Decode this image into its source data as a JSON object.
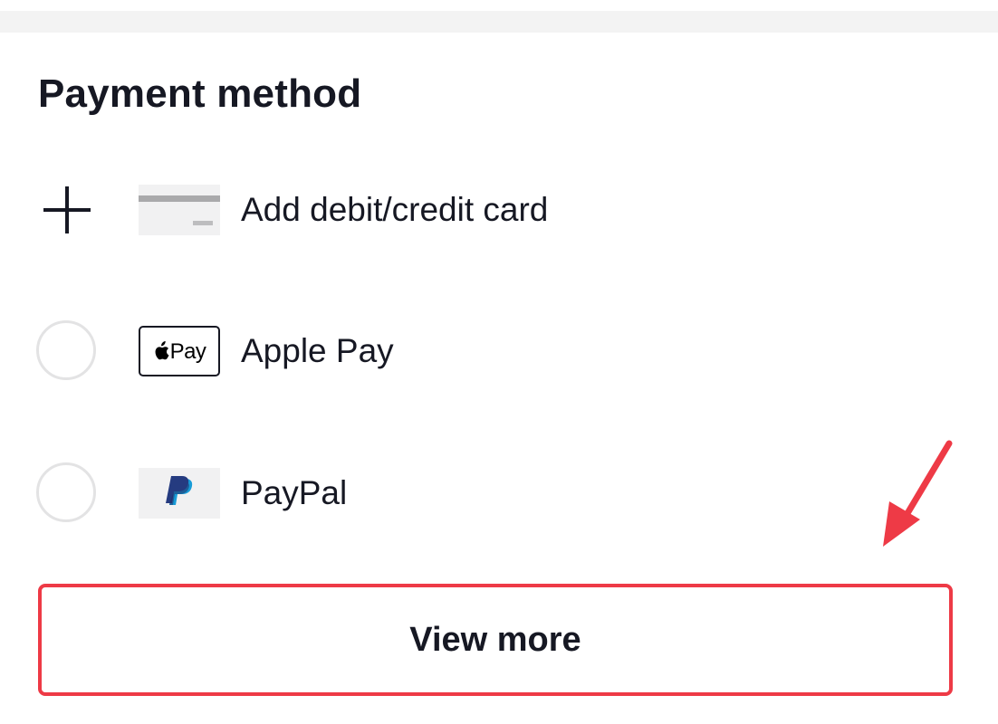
{
  "section": {
    "title": "Payment method"
  },
  "methods": [
    {
      "label": "Add debit/credit card",
      "leading_icon": "plus-icon",
      "logo": "card-icon"
    },
    {
      "label": "Apple Pay",
      "leading_icon": "radio-unselected",
      "logo": "apple-pay-logo",
      "logo_text": "Pay"
    },
    {
      "label": "PayPal",
      "leading_icon": "radio-unselected",
      "logo": "paypal-logo"
    }
  ],
  "view_more": {
    "label": "View more"
  },
  "colors": {
    "text": "#161823",
    "highlight": "#ee3a46",
    "radio_border": "#e3e3e4",
    "logo_bg": "#f1f1f2",
    "paypal_dark": "#253b80",
    "paypal_light": "#179bd7"
  },
  "annotation": {
    "icon": "red-arrow-icon"
  }
}
